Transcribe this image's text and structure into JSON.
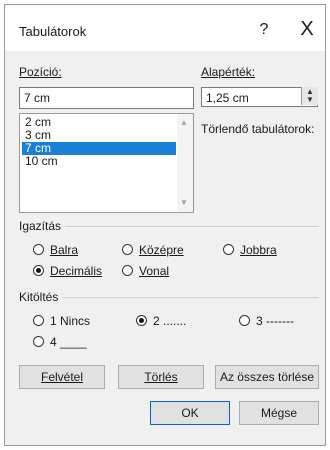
{
  "dialog": {
    "title": "Tabulátorok",
    "help_glyph": "?",
    "close_glyph": "X"
  },
  "position": {
    "label": "Pozíció:",
    "value": "7 cm",
    "list": [
      "2 cm",
      "3 cm",
      "7 cm",
      "10 cm"
    ],
    "selected": "7 cm"
  },
  "default_tab": {
    "label": "Alapérték:",
    "value": "1,25 cm"
  },
  "clear_label": "Törlendő tabulátorok:",
  "alignment": {
    "title": "Igazítás",
    "options": [
      {
        "label": "Balra",
        "checked": false
      },
      {
        "label": "Középre",
        "checked": false
      },
      {
        "label": "Jobbra",
        "checked": false
      },
      {
        "label": "Decimális",
        "checked": true
      },
      {
        "label": "Vonal",
        "checked": false
      }
    ]
  },
  "leader": {
    "title": "Kitöltés",
    "options": [
      {
        "label": "1 Nincs",
        "checked": false
      },
      {
        "label": "2 .......",
        "checked": true
      },
      {
        "label": "3 -------",
        "checked": false
      },
      {
        "label": "4 ____",
        "checked": false
      }
    ]
  },
  "buttons": {
    "set": "Felvétel",
    "clear": "Törlés",
    "clear_all": "Az összes törlése",
    "ok": "OK",
    "cancel": "Mégse"
  }
}
